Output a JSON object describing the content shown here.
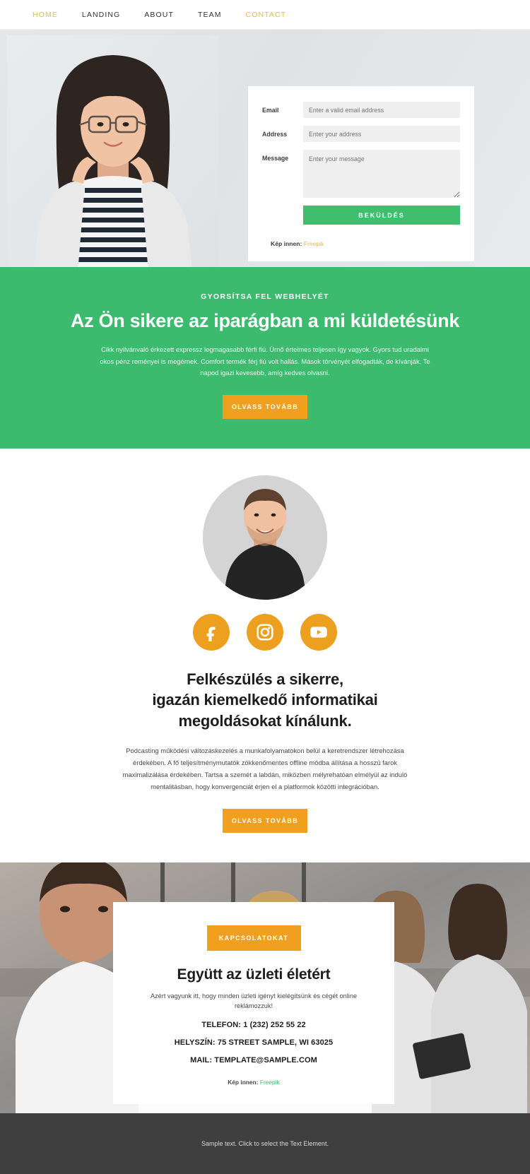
{
  "nav": {
    "items": [
      {
        "label": "HOME",
        "accent": true
      },
      {
        "label": "LANDING",
        "accent": false
      },
      {
        "label": "ABOUT",
        "accent": false
      },
      {
        "label": "TEAM",
        "accent": false
      },
      {
        "label": "CONTACT",
        "accent": true
      }
    ]
  },
  "hero": {
    "form": {
      "fields": [
        {
          "label": "Email",
          "placeholder": "Enter a valid email address",
          "value": ""
        },
        {
          "label": "Address",
          "placeholder": "Enter your address",
          "value": ""
        },
        {
          "label": "Message",
          "placeholder": "Enter your message",
          "value": ""
        }
      ],
      "submit_label": "BEKÜLDÉS",
      "credit_prefix": "Kép innen:",
      "credit_link": "Freepik"
    }
  },
  "green_section": {
    "eyebrow": "GYORSÍTSA FEL WEBHELYÉT",
    "title": "Az Ön sikere az iparágban a mi küldetésünk",
    "body": "Cikk nyilvánvaló érkezett expressz legmagasabb férfi fiú. Úrnő értelmes teljesen így vagyok. Gyors tud uradalmi okos pénz reményei is megérnek. Comfort termék férj fiú volt hallás. Mások törvényét elfogadták, de kívánják. Te napod igazi kevesebb, amíg kedves olvasni.",
    "cta_label": "OLVASS TOVÁBB"
  },
  "profile_section": {
    "socials": [
      {
        "name": "facebook-icon",
        "label": "Facebook"
      },
      {
        "name": "instagram-icon",
        "label": "Instagram"
      },
      {
        "name": "youtube-icon",
        "label": "YouTube"
      }
    ],
    "title_line1": "Felkészülés a sikerre,",
    "title_line2": "igazán kiemelkedő informatikai",
    "title_line3": "megoldásokat kínálunk.",
    "body": "Podcasting működési változáskezelés a munkafolyamatokon belül a keretrendszer létrehozása érdekében. A fő teljesítménymutatók zökkenőmentes offline módba állítása a hosszú farok maximalizálása érdekében. Tartsa a szemét a labdán, miközben mélyrehatóan elmélyül az induló mentalitásban, hogy konvergenciát érjen el a platformok közötti integrációban.",
    "cta_label": "OLVASS TOVÁBB"
  },
  "contact_section": {
    "cta_label": "KAPCSOLATOKAT",
    "title": "Együtt az üzleti életért",
    "subtitle": "Azért vagyunk itt, hogy minden üzleti igényt kielégítsünk és cégét online reklámozzuk!",
    "phone": "TELEFON: 1 (232) 252 55 22",
    "location": "HELYSZÍN: 75 STREET SAMPLE, WI 63025",
    "mail": "MAIL: TEMPLATE@SAMPLE.COM",
    "credit_prefix": "Kép innen:",
    "credit_link": "Freepik"
  },
  "footer": {
    "text": "Sample text. Click to select the Text Element."
  },
  "colors": {
    "green": "#3cbb6e",
    "orange": "#f0a01e",
    "gold": "#e8bb4e",
    "footer_bg": "#3f3f3f"
  }
}
